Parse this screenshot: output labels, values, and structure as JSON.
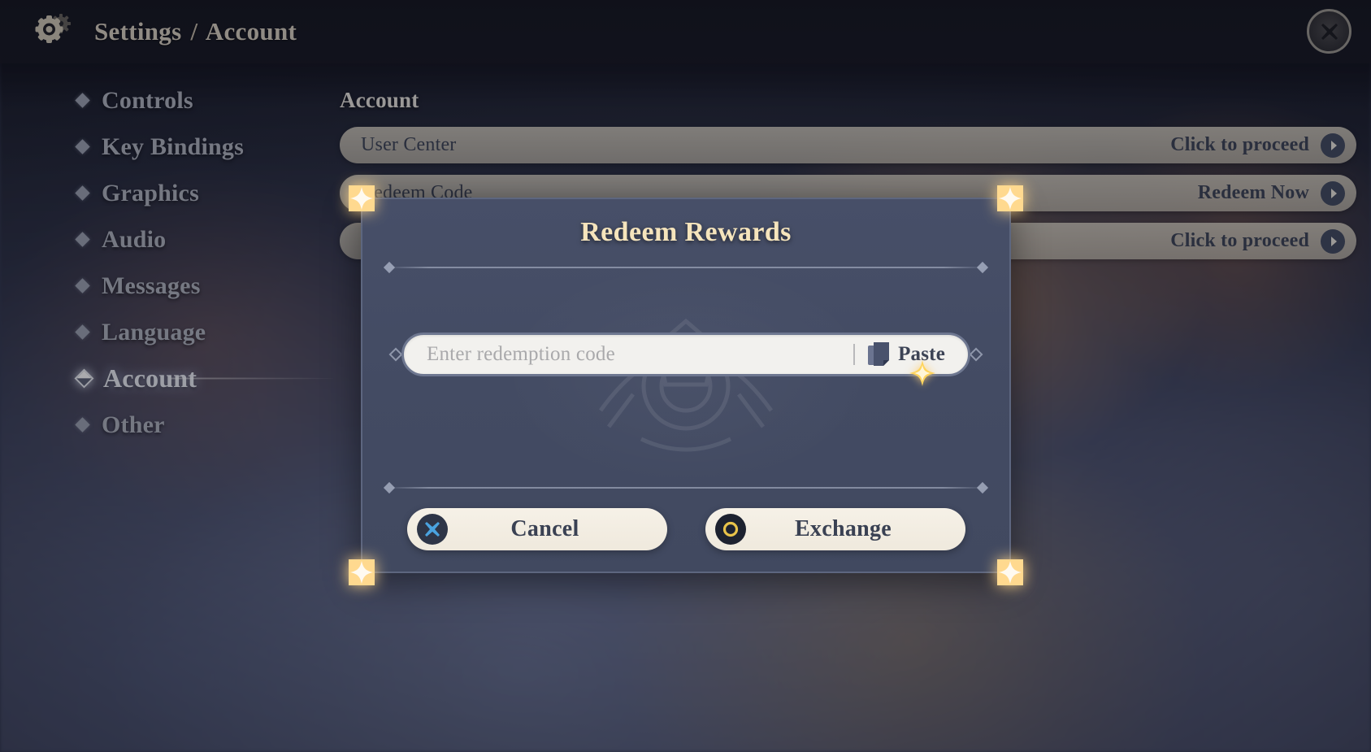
{
  "header": {
    "gear_icon": "gear-icon",
    "breadcrumb_root": "Settings",
    "breadcrumb_separator": "/",
    "breadcrumb_current": "Account",
    "close_icon": "close-icon"
  },
  "sidebar": {
    "items": [
      {
        "label": "Controls",
        "active": false
      },
      {
        "label": "Key Bindings",
        "active": false
      },
      {
        "label": "Graphics",
        "active": false
      },
      {
        "label": "Audio",
        "active": false
      },
      {
        "label": "Messages",
        "active": false
      },
      {
        "label": "Language",
        "active": false
      },
      {
        "label": "Account",
        "active": true
      },
      {
        "label": "Other",
        "active": false
      }
    ]
  },
  "main": {
    "title": "Account",
    "rows": [
      {
        "label": "User Center",
        "action": "Click to proceed",
        "icon": "chevron-right-icon"
      },
      {
        "label": "Redeem Code",
        "action": "Redeem Now",
        "icon": "chevron-right-icon"
      },
      {
        "label": "",
        "action": "Click to proceed",
        "icon": "chevron-right-icon"
      }
    ]
  },
  "dialog": {
    "title": "Redeem Rewards",
    "input": {
      "value": "",
      "placeholder": "Enter redemption code",
      "paste_label": "Paste",
      "paste_icon": "clipboard-icon"
    },
    "buttons": [
      {
        "label": "Cancel",
        "badge": "x-icon",
        "badge_color": "#4aa3e0"
      },
      {
        "label": "Exchange",
        "badge": "circle-icon",
        "badge_color": "#e8c34a"
      }
    ],
    "corner_ornament": "star-corner-icon"
  },
  "cursor": {
    "icon": "sparkle-cursor-icon"
  },
  "colors": {
    "dialog_bg": "#434b63",
    "dialog_border": "#5d667f",
    "gold_title": "#f5e4bc",
    "button_cream": "#f2ece0",
    "row_cream": "#d6d0c2",
    "ink": "#3c4355",
    "cancel_blue": "#4aa3e0",
    "exchange_gold": "#e8c34a",
    "ornament_glow": "#ffd68c"
  }
}
